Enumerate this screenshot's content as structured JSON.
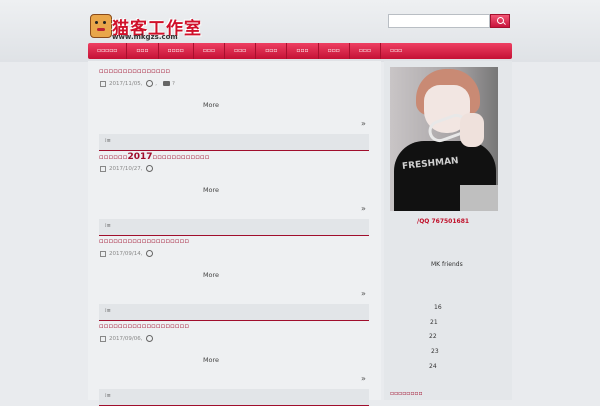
{
  "header": {
    "brand": "猫客工作室",
    "url": "www.mkgzs.com",
    "search_placeholder": ""
  },
  "nav": {
    "items": [
      "▫▫▫▫▫",
      "▫▫▫",
      "▫▫▫▫",
      "▫▫▫",
      "▫▫▫",
      "▫▫▫",
      "▫▫▫",
      "▫▫▫",
      "▫▫▫",
      "▫▫▫"
    ]
  },
  "posts": [
    {
      "title": "▫▫▫▫▫▫▫▫▫▫▫▫▫▫▫",
      "title_highlight": "",
      "title_rest": "",
      "date": "2017/11/05,",
      "comma": ",",
      "comments": "?",
      "more": "More",
      "arrow": "»",
      "section": "⁞≡"
    },
    {
      "title": "▫▫▫▫▫▫",
      "title_highlight": "2017",
      "title_rest": "▫▫▫▫▫▫▫▫▫▫▫▫",
      "date": "2017/10/27,",
      "comma": "",
      "comments": "",
      "more": "More",
      "arrow": "»",
      "section": "⁞≡"
    },
    {
      "title": "▫▫▫▫▫▫▫▫▫▫▫▫▫▫▫▫▫▫▫",
      "title_highlight": "",
      "title_rest": "",
      "date": "2017/09/14,",
      "comma": "",
      "comments": "",
      "more": "More",
      "arrow": "»",
      "section": "⁞≡"
    },
    {
      "title": "▫▫▫▫▫▫▫▫▫▫▫▫▫▫▫▫▫▫▫",
      "title_highlight": "",
      "title_rest": "",
      "date": "2017/09/06,",
      "comma": "",
      "comments": "",
      "more": "More",
      "arrow": "»",
      "section": "⁞≡"
    }
  ],
  "sidebar": {
    "photo_shirt_text": "FRESHMAN",
    "qq": "/QQ  767501681",
    "friends": "MK friends",
    "numbers": [
      "16",
      "21",
      "22",
      "23",
      "24"
    ],
    "heading": "▫▫▫▫▫▫▫▫"
  },
  "colors": {
    "accent": "#c41135",
    "title": "#a00e2c",
    "background": "#e9ebee"
  }
}
